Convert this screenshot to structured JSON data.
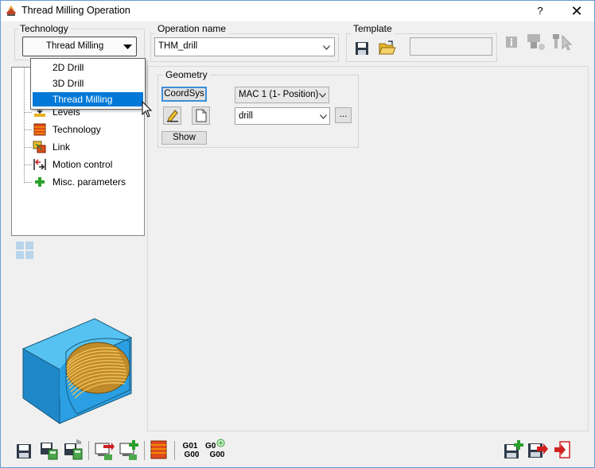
{
  "window": {
    "title": "Thread Milling Operation",
    "help_label": "?",
    "close_label": "✕"
  },
  "technology": {
    "group_label": "Technology",
    "selected": "Thread Milling"
  },
  "dropdown": {
    "items": [
      "2D Drill",
      "3D Drill",
      "Thread Milling"
    ],
    "selected_index": 2
  },
  "operation_name": {
    "group_label": "Operation name",
    "value": "THM_drill"
  },
  "template": {
    "group_label": "Template",
    "value": ""
  },
  "tree": {
    "items": [
      "Levels",
      "Technology",
      "Link",
      "Motion control",
      "Misc. parameters"
    ]
  },
  "geometry": {
    "group_label": "Geometry",
    "coordsys_label": "CoordSys",
    "mac_value": "MAC 1 (1- Position)",
    "geometry_value": "drill",
    "more_label": "...",
    "show_label": "Show"
  },
  "bottom_toolbar": {
    "g01_label": "G01",
    "g00_label": "G00",
    "g0_label": "G0",
    "g00b_label": "G00"
  },
  "colors": {
    "accent": "#0078d7",
    "part_blue": "#2a9fe3",
    "thread_gold": "#d9a43a"
  }
}
